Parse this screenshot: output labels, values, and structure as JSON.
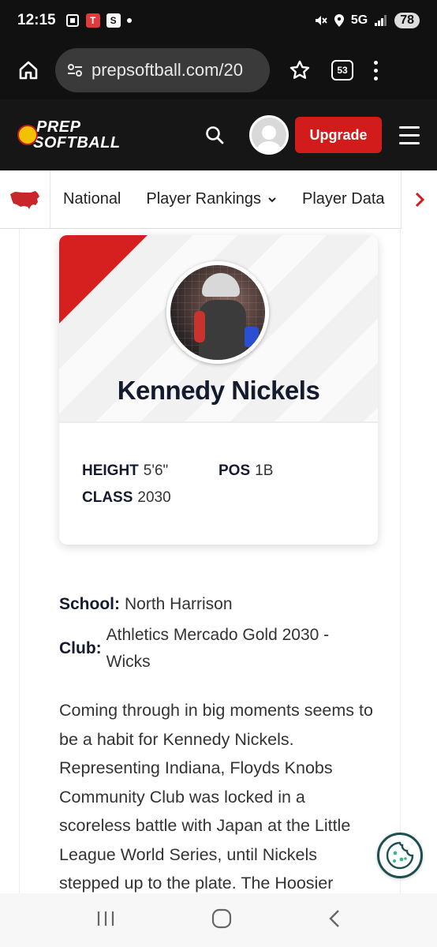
{
  "status_bar": {
    "time": "12:15",
    "network": "5G",
    "battery": "78"
  },
  "browser": {
    "url": "prepsoftball.com/20",
    "tab_count": "53"
  },
  "site_header": {
    "logo_line1": "PREP",
    "logo_line2": "SOFTBALL",
    "upgrade_label": "Upgrade"
  },
  "subnav": {
    "items": [
      {
        "label": "National"
      },
      {
        "label": "Player Rankings"
      },
      {
        "label": "Player Data"
      }
    ]
  },
  "player": {
    "name": "Kennedy Nickels",
    "height_label": "HEIGHT",
    "height_value": "5'6\"",
    "pos_label": "POS",
    "pos_value": "1B",
    "class_label": "CLASS",
    "class_value": "2030",
    "school_label": "School:",
    "school_value": "North Harrison",
    "club_label": "Club:",
    "club_value": "Athletics Mercado Gold 2030 - Wicks",
    "bio": "Coming through in big moments seems to be a habit for Kennedy Nickels. Representing Indiana, Floyds Knobs Community Club was locked in a scoreless battle with Japan at the Little League World Series, until Nickels stepped up to the plate. The Hoosier"
  },
  "colors": {
    "accent_red": "#d21b1b",
    "header_bg": "#161616",
    "name_navy": "#151b2e"
  }
}
